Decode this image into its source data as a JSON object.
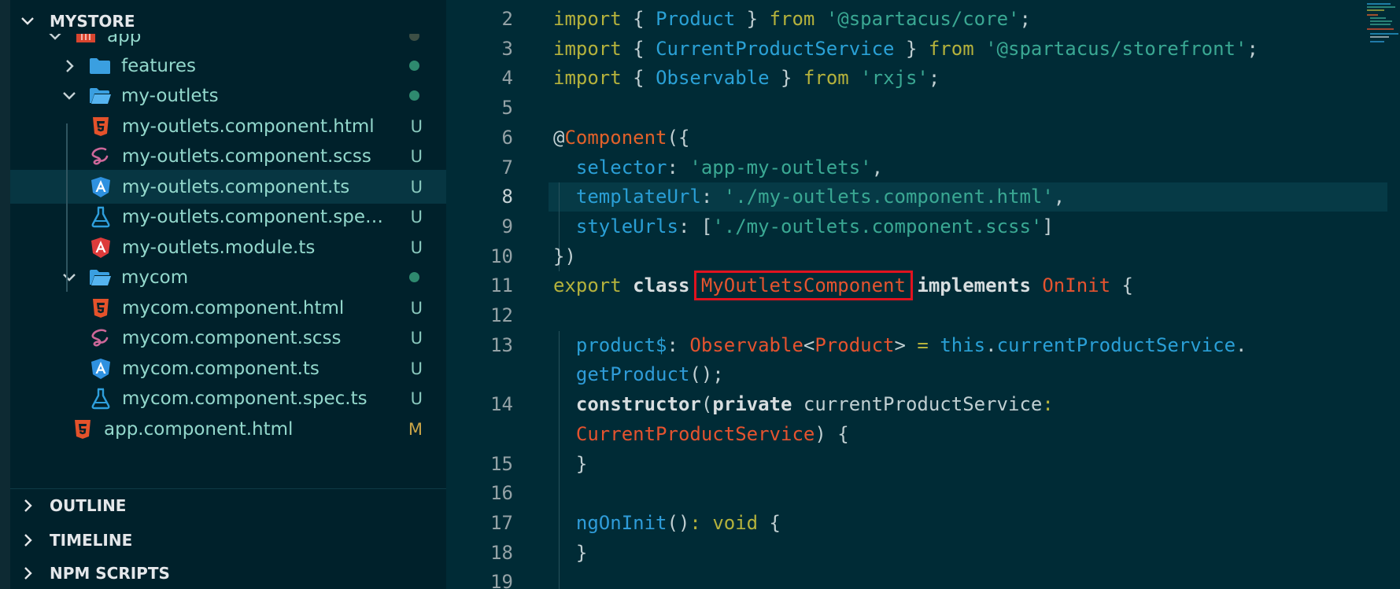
{
  "explorer": {
    "root_label": "MYSTORE",
    "tree": [
      {
        "label": "app",
        "type": "folder-open-partial",
        "indent": 1
      },
      {
        "label": "features",
        "type": "folder",
        "indent": 2
      },
      {
        "label": "my-outlets",
        "type": "folder-open",
        "indent": 2
      },
      {
        "label": "my-outlets.component.html",
        "type": "html",
        "badge": "U"
      },
      {
        "label": "my-outlets.component.scss",
        "type": "scss",
        "badge": "U"
      },
      {
        "label": "my-outlets.component.ts",
        "type": "angular-ts",
        "badge": "U",
        "selected": true
      },
      {
        "label": "my-outlets.component.spec.ts",
        "type": "spec",
        "badge": "U"
      },
      {
        "label": "my-outlets.module.ts",
        "type": "angular-module",
        "badge": "U"
      },
      {
        "label": "mycom",
        "type": "folder-open",
        "indent": 2
      },
      {
        "label": "mycom.component.html",
        "type": "html",
        "badge": "U"
      },
      {
        "label": "mycom.component.scss",
        "type": "scss",
        "badge": "U"
      },
      {
        "label": "mycom.component.ts",
        "type": "angular-ts",
        "badge": "U"
      },
      {
        "label": "mycom.component.spec.ts",
        "type": "spec",
        "badge": "U"
      },
      {
        "label": "app.component.html",
        "type": "html",
        "badge": "M"
      }
    ],
    "sections": [
      "OUTLINE",
      "TIMELINE",
      "NPM SCRIPTS"
    ]
  },
  "editor": {
    "line_numbers": [
      "2",
      "3",
      "4",
      "5",
      "6",
      "7",
      "8",
      "9",
      "10",
      "11",
      "12",
      "13",
      "",
      "14",
      "",
      "15",
      "16",
      "17",
      "18",
      "19"
    ],
    "highlight": "MyOutletsComponent",
    "lines": [
      [
        [
          "kw",
          "import "
        ],
        [
          "pu",
          "{ "
        ],
        [
          "ty",
          "Product"
        ],
        [
          "pu",
          " } "
        ],
        [
          "kw",
          "from "
        ],
        [
          "st",
          "'@spartacus/core'"
        ],
        [
          "pu",
          ";"
        ]
      ],
      [
        [
          "kw",
          "import "
        ],
        [
          "pu",
          "{ "
        ],
        [
          "ty",
          "CurrentProductService"
        ],
        [
          "pu",
          " } "
        ],
        [
          "kw",
          "from "
        ],
        [
          "st",
          "'@spartacus/storefront'"
        ],
        [
          "pu",
          ";"
        ]
      ],
      [
        [
          "kw",
          "import "
        ],
        [
          "pu",
          "{ "
        ],
        [
          "ty",
          "Observable"
        ],
        [
          "pu",
          " } "
        ],
        [
          "kw",
          "from "
        ],
        [
          "st",
          "'rxjs'"
        ],
        [
          "pu",
          ";"
        ]
      ],
      [],
      [
        [
          "pu",
          "@"
        ],
        [
          "de",
          "Component"
        ],
        [
          "pu",
          "({"
        ]
      ],
      [
        [
          "pu",
          "  "
        ],
        [
          "pr",
          "selector"
        ],
        [
          "pu",
          ": "
        ],
        [
          "st",
          "'app-my-outlets'"
        ],
        [
          "pu",
          ","
        ]
      ],
      [
        [
          "pu",
          "  "
        ],
        [
          "pr",
          "templateUrl"
        ],
        [
          "pu",
          ": "
        ],
        [
          "st",
          "'./my-outlets.component.html'"
        ],
        [
          "pu",
          ","
        ]
      ],
      [
        [
          "pu",
          "  "
        ],
        [
          "pr",
          "styleUrls"
        ],
        [
          "pu",
          ": ["
        ],
        [
          "st",
          "'./my-outlets.component.scss'"
        ],
        [
          "pu",
          "]"
        ]
      ],
      [
        [
          "pu",
          "})"
        ]
      ],
      [
        [
          "kw",
          "export "
        ],
        [
          "bo",
          "class "
        ],
        [
          "cl",
          "MyOutletsComponent"
        ],
        [
          "pu",
          " "
        ],
        [
          "bo",
          "implements "
        ],
        [
          "cl",
          "OnInit"
        ],
        [
          "pu",
          " {"
        ]
      ],
      [],
      [
        [
          "pu",
          "  "
        ],
        [
          "pr",
          "product$"
        ],
        [
          "pu",
          ": "
        ],
        [
          "cl",
          "Observable"
        ],
        [
          "pu",
          "<"
        ],
        [
          "cl",
          "Product"
        ],
        [
          "pu",
          "> "
        ],
        [
          "kw",
          "= "
        ],
        [
          "ty",
          "this"
        ],
        [
          "pu",
          "."
        ],
        [
          "pr",
          "currentProductService"
        ],
        [
          "pu",
          "."
        ]
      ],
      [
        [
          "pu",
          "  "
        ],
        [
          "fn",
          "getProduct"
        ],
        [
          "pu",
          "();"
        ]
      ],
      [
        [
          "pu",
          "  "
        ],
        [
          "bo",
          "constructor"
        ],
        [
          "pu",
          "("
        ],
        [
          "bo",
          "private "
        ],
        [
          "pu",
          "currentProductService"
        ],
        [
          "kw",
          ":"
        ]
      ],
      [
        [
          "pu",
          "  "
        ],
        [
          "cl",
          "CurrentProductService"
        ],
        [
          "pu",
          ") {"
        ]
      ],
      [
        [
          "pu",
          "  }"
        ]
      ],
      [],
      [
        [
          "pu",
          "  "
        ],
        [
          "fn",
          "ngOnInit"
        ],
        [
          "pu",
          "()"
        ],
        [
          "kw",
          ": "
        ],
        [
          "kw",
          "void"
        ],
        [
          "pu",
          " {"
        ]
      ],
      [
        [
          "pu",
          "  }"
        ]
      ],
      []
    ]
  }
}
